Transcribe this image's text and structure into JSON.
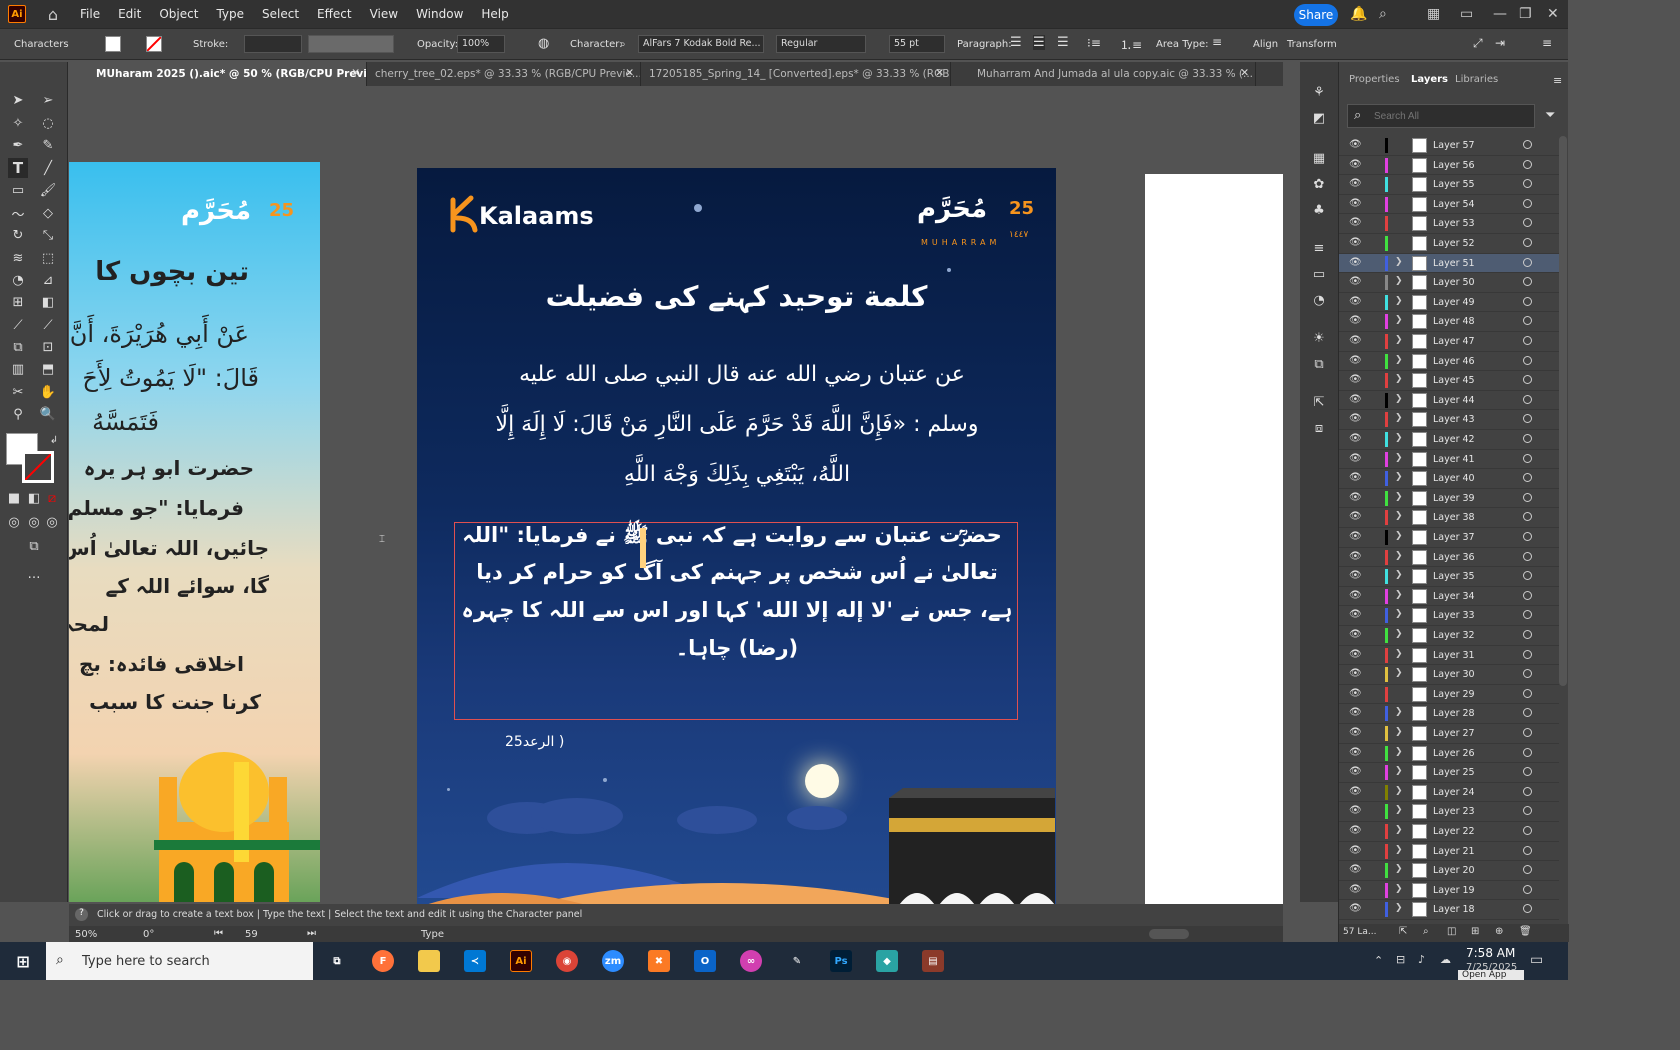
{
  "menubar": {
    "app_logo": "Ai",
    "items": [
      "File",
      "Edit",
      "Object",
      "Type",
      "Select",
      "Effect",
      "View",
      "Window",
      "Help"
    ],
    "share_label": "Share"
  },
  "control": {
    "panel_label": "Characters",
    "stroke_label": "Stroke:",
    "opacity_label": "Opacity:",
    "opacity_value": "100%",
    "character_label": "Character:",
    "font_name": "AlFars 7 Kodak Bold Re...",
    "font_style": "Regular",
    "font_size": "55 pt",
    "paragraph_label": "Paragraph:",
    "area_type_label": "Area Type:",
    "align_label": "Align",
    "transform_label": "Transform"
  },
  "tabs": [
    {
      "label": "MUharam 2025 ().aic* @ 50 % (RGB/CPU Preview)"
    },
    {
      "label": "cherry_tree_02.eps* @ 33.33 % (RGB/CPU Previe..."
    },
    {
      "label": "17205185_Spring_14_ [Converted].eps* @ 33.33 % (RGB..."
    },
    {
      "label": "Muharram And Jumada al ula copy.aic @ 33.33 % (..."
    }
  ],
  "artboard_left": {
    "header_num": "25",
    "header_ar": "مُحَرَّم",
    "title": "تین بچوں کا",
    "line1": "عَنْ أَبِي هُرَيْرَةَ، أَنَّ",
    "line2": "قَالَ: \"لَا يَمُوتُ لِأَحَ",
    "line3": "فَتَمَسَّهُ",
    "line4": "حضرت ابو ہر یرہ",
    "line5": "فرمایا: \"جو مسلم",
    "line6": "جائیں، اللہ تعالیٰ اُس",
    "line7": "گا، سوائے اللہ کے",
    "line8": "لمحہ",
    "line9": "اخلاقی فائدہ: بچ",
    "line10": "کرنا جنت کا سبب"
  },
  "artboard_main": {
    "brand": "Kalaams",
    "header_num": "25",
    "header_ar": "مُحَرَّم",
    "header_sub": "MUHARRAM",
    "header_year": "١٤٤٧",
    "title": "كلمة توحید کہنے کی فضیلت",
    "arabic1": "عن عتبان رضي الله عنه قال النبي صلى الله عليه",
    "arabic2": "وسلم : «فَإِنَّ اللَّهَ قَدْ حَرَّمَ عَلَى النَّارِ مَنْ قَالَ: لَا إِلَهَ إِلَّا",
    "arabic3": "اللَّهُ، يَبْتَغِي بِذَلِكَ وَجْهَ اللَّهِ",
    "urdu1": "حضرؒت عتبان سے روایت ہے کہ نبی ﷺ نے فرمایا: \"اللہ",
    "urdu2": "تعالیٰ نے اُس شخص پر جہنم کی آگ کو حرام کر دیا",
    "urdu3": "ہے، جس نے 'لا إله إلا الله' کہا اور اس سے اللہ کا چہرہ",
    "urdu4": "(رضا) چاہا۔",
    "reference": "( الرعد25"
  },
  "panel": {
    "tabs": [
      "Properties",
      "Layers",
      "Libraries"
    ],
    "search_placeholder": "Search All",
    "layers": [
      {
        "name": "Layer 57",
        "color": "#000000",
        "chev": false
      },
      {
        "name": "Layer 56",
        "color": "#e040e0",
        "chev": false
      },
      {
        "name": "Layer 55",
        "color": "#40e0e0",
        "chev": false
      },
      {
        "name": "Layer 54",
        "color": "#e040e0",
        "chev": false
      },
      {
        "name": "Layer 53",
        "color": "#e04040",
        "chev": false
      },
      {
        "name": "Layer 52",
        "color": "#40e040",
        "chev": false
      },
      {
        "name": "Layer 51",
        "color": "#4060e0",
        "chev": true,
        "selected": true
      },
      {
        "name": "Layer 50",
        "color": "#888888",
        "chev": true
      },
      {
        "name": "Layer 49",
        "color": "#40e0e0",
        "chev": true
      },
      {
        "name": "Layer 48",
        "color": "#e040e0",
        "chev": true
      },
      {
        "name": "Layer 47",
        "color": "#e04040",
        "chev": true
      },
      {
        "name": "Layer 46",
        "color": "#40e040",
        "chev": true
      },
      {
        "name": "Layer 45",
        "color": "#e04040",
        "chev": true
      },
      {
        "name": "Layer 44",
        "color": "#000000",
        "chev": true
      },
      {
        "name": "Layer 43",
        "color": "#e04040",
        "chev": true
      },
      {
        "name": "Layer 42",
        "color": "#40e0e0",
        "chev": true
      },
      {
        "name": "Layer 41",
        "color": "#e040e0",
        "chev": true
      },
      {
        "name": "Layer 40",
        "color": "#4060e0",
        "chev": true
      },
      {
        "name": "Layer 39",
        "color": "#40e040",
        "chev": true
      },
      {
        "name": "Layer 38",
        "color": "#e04040",
        "chev": true
      },
      {
        "name": "Layer 37",
        "color": "#000000",
        "chev": true
      },
      {
        "name": "Layer 36",
        "color": "#e04040",
        "chev": true
      },
      {
        "name": "Layer 35",
        "color": "#40e0e0",
        "chev": true
      },
      {
        "name": "Layer 34",
        "color": "#e040e0",
        "chev": true
      },
      {
        "name": "Layer 33",
        "color": "#4060e0",
        "chev": true
      },
      {
        "name": "Layer 32",
        "color": "#40e040",
        "chev": true
      },
      {
        "name": "Layer 31",
        "color": "#e04040",
        "chev": true
      },
      {
        "name": "Layer 30",
        "color": "#e0c040",
        "chev": true
      },
      {
        "name": "Layer 29",
        "color": "#e04040",
        "chev": false
      },
      {
        "name": "Layer 28",
        "color": "#4060e0",
        "chev": true
      },
      {
        "name": "Layer 27",
        "color": "#e0c040",
        "chev": true
      },
      {
        "name": "Layer 26",
        "color": "#40e040",
        "chev": true
      },
      {
        "name": "Layer 25",
        "color": "#e040e0",
        "chev": true
      },
      {
        "name": "Layer 24",
        "color": "#808000",
        "chev": true
      },
      {
        "name": "Layer 23",
        "color": "#40e040",
        "chev": true
      },
      {
        "name": "Layer 22",
        "color": "#e04040",
        "chev": true
      },
      {
        "name": "Layer 21",
        "color": "#e04040",
        "chev": true
      },
      {
        "name": "Layer 20",
        "color": "#40e040",
        "chev": true
      },
      {
        "name": "Layer 19",
        "color": "#e040e0",
        "chev": true
      },
      {
        "name": "Layer 18",
        "color": "#4060e0",
        "chev": true
      }
    ],
    "footer_count": "57 La..."
  },
  "status": {
    "hint": "Click or drag to create a text box  |  Type the text  |  Select the text and edit it using the Character panel",
    "zoom": "50%",
    "rotation": "0°",
    "page": "59",
    "tool": "Type"
  },
  "taskbar": {
    "search_placeholder": "Type here to search",
    "time": "7:58 AM",
    "date": "7/25/2025",
    "tooltip": "Open App"
  }
}
